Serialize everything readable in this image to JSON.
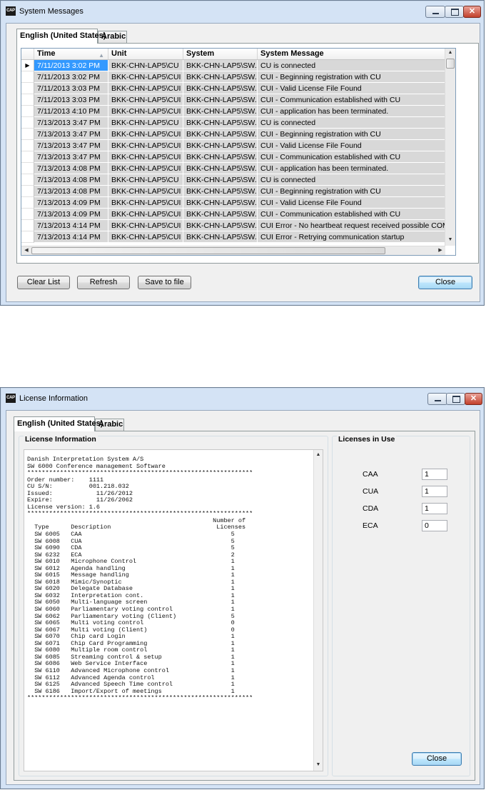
{
  "system_messages": {
    "title": "System Messages",
    "app_icon": "CAP",
    "tabs": [
      "English (United States)",
      "Arabic"
    ],
    "columns": [
      "Time",
      "Unit",
      "System",
      "System Message"
    ],
    "rows": [
      {
        "time": "7/11/2013 3:02 PM",
        "unit": "BKK-CHN-LAP5\\CU",
        "system": "BKK-CHN-LAP5\\SW...",
        "message": "CU is connected"
      },
      {
        "time": "7/11/2013 3:02 PM",
        "unit": "BKK-CHN-LAP5\\CUI",
        "system": "BKK-CHN-LAP5\\SW...",
        "message": "CUI - Beginning registration with CU"
      },
      {
        "time": "7/11/2013 3:03 PM",
        "unit": "BKK-CHN-LAP5\\CUI",
        "system": "BKK-CHN-LAP5\\SW...",
        "message": "CUI - Valid License File Found"
      },
      {
        "time": "7/11/2013 3:03 PM",
        "unit": "BKK-CHN-LAP5\\CUI",
        "system": "BKK-CHN-LAP5\\SW...",
        "message": "CUI - Communication established with CU"
      },
      {
        "time": "7/11/2013 4:10 PM",
        "unit": "BKK-CHN-LAP5\\CUI",
        "system": "BKK-CHN-LAP5\\SW...",
        "message": "CUI - application has been terminated."
      },
      {
        "time": "7/13/2013 3:47 PM",
        "unit": "BKK-CHN-LAP5\\CU",
        "system": "BKK-CHN-LAP5\\SW...",
        "message": "CU is connected"
      },
      {
        "time": "7/13/2013 3:47 PM",
        "unit": "BKK-CHN-LAP5\\CUI",
        "system": "BKK-CHN-LAP5\\SW...",
        "message": "CUI - Beginning registration with CU"
      },
      {
        "time": "7/13/2013 3:47 PM",
        "unit": "BKK-CHN-LAP5\\CUI",
        "system": "BKK-CHN-LAP5\\SW...",
        "message": "CUI - Valid License File Found"
      },
      {
        "time": "7/13/2013 3:47 PM",
        "unit": "BKK-CHN-LAP5\\CUI",
        "system": "BKK-CHN-LAP5\\SW...",
        "message": "CUI - Communication established with CU"
      },
      {
        "time": "7/13/2013 4:08 PM",
        "unit": "BKK-CHN-LAP5\\CUI",
        "system": "BKK-CHN-LAP5\\SW...",
        "message": "CUI - application has been terminated."
      },
      {
        "time": "7/13/2013 4:08 PM",
        "unit": "BKK-CHN-LAP5\\CU",
        "system": "BKK-CHN-LAP5\\SW...",
        "message": "CU is connected"
      },
      {
        "time": "7/13/2013 4:08 PM",
        "unit": "BKK-CHN-LAP5\\CUI",
        "system": "BKK-CHN-LAP5\\SW...",
        "message": "CUI - Beginning registration with CU"
      },
      {
        "time": "7/13/2013 4:09 PM",
        "unit": "BKK-CHN-LAP5\\CUI",
        "system": "BKK-CHN-LAP5\\SW...",
        "message": "CUI - Valid License File Found"
      },
      {
        "time": "7/13/2013 4:09 PM",
        "unit": "BKK-CHN-LAP5\\CUI",
        "system": "BKK-CHN-LAP5\\SW...",
        "message": "CUI - Communication established with CU"
      },
      {
        "time": "7/13/2013 4:14 PM",
        "unit": "BKK-CHN-LAP5\\CUI",
        "system": "BKK-CHN-LAP5\\SW...",
        "message": "CUI Error - No heartbeat request received possible COMM lo"
      },
      {
        "time": "7/13/2013 4:14 PM",
        "unit": "BKK-CHN-LAP5\\CUI",
        "system": "BKK-CHN-LAP5\\SW...",
        "message": "CUI Error - Retrying communication startup"
      }
    ],
    "buttons": {
      "clear": "Clear List",
      "refresh": "Refresh",
      "save": "Save to file",
      "close": "Close"
    }
  },
  "license_info": {
    "title": "License Information",
    "app_icon": "CAP",
    "tabs": [
      "English (United States)",
      "Arabic"
    ],
    "info_group_label": "License Information",
    "in_use_group_label": "Licenses in Use",
    "license_text": [
      "Danish Interpretation System A/S",
      "SW 6000 Conference management Software",
      "**************************************************************",
      "Order number:    1111",
      "CU S/N:          001.218.032",
      "Issued:            11/26/2012",
      "Expire:            11/26/2062",
      "License version: 1.6",
      "**************************************************************",
      "                                                   Number of",
      "  Type      Description                             Licenses",
      "  SW 6005   CAA                                         5",
      "  SW 6008   CUA                                         5",
      "  SW 6090   CDA                                         5",
      "  SW 6232   ECA                                         2",
      "  SW 6010   Microphone Control                          1",
      "  SW 6012   Agenda handling                             1",
      "  SW 6015   Message handling                            1",
      "  SW 6018   Mimic/Synoptic                              1",
      "  SW 6020   Delegate Database                           1",
      "  SW 6032   Interpretation cont.                        1",
      "  SW 6050   Multi-language screen                       1",
      "  SW 6060   Parliamentary voting control                1",
      "  SW 6062   Parliamentary voting (Client)               5",
      "  SW 6065   Multi voting control                        0",
      "  SW 6067   Multi voting (Client)                       0",
      "  SW 6070   Chip card Login                             1",
      "  SW 6071   Chip Card Programming                       1",
      "  SW 6080   Multiple room control                       1",
      "  SW 6085   Streaming control & setup                   1",
      "  SW 6086   Web Service Interface                       1",
      "  SW 6110   Advanced Microphone control                 1",
      "  SW 6112   Advanced Agenda control                     1",
      "  SW 6125   Advanced Speech Time control                1",
      "  SW 6186   Import/Export of meetings                   1",
      "**************************************************************"
    ],
    "in_use": [
      {
        "name": "CAA",
        "value": "1"
      },
      {
        "name": "CUA",
        "value": "1"
      },
      {
        "name": "CDA",
        "value": "1"
      },
      {
        "name": "ECA",
        "value": "0"
      }
    ],
    "close_label": "Close"
  }
}
